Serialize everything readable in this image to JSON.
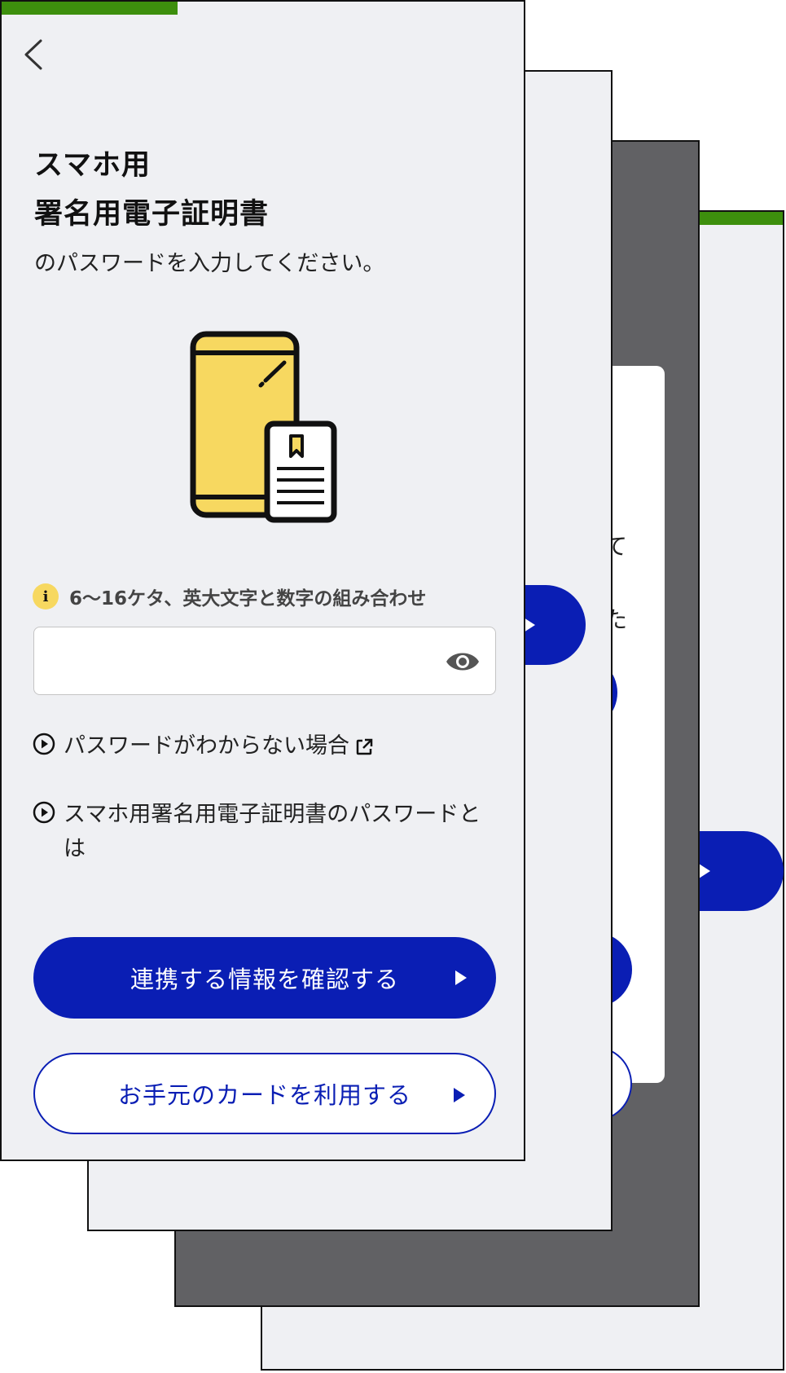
{
  "screen": {
    "title_line1": "スマホ用",
    "title_line2": "署名用電子証明書",
    "subtitle": "のパスワードを入力してください。"
  },
  "password_field": {
    "hint_icon": "i",
    "hint": "6〜16ケタ、英大文字と数字の組み合わせ",
    "value": "",
    "placeholder": "",
    "toggle_icon": "eye-icon"
  },
  "links": [
    {
      "label": "パスワードがわからない場合",
      "icon": "external-link-icon"
    },
    {
      "label": "スマホ用署名用電子証明書のパスワードとは"
    }
  ],
  "buttons": {
    "primary": "連携する情報を確認する",
    "secondary": "お手元のカードを利用する"
  },
  "background_sheets": {
    "dialog_fragments": [
      "て",
      "た"
    ]
  },
  "colors": {
    "progress": "#3d8f0d",
    "primary": "#0a1eb4",
    "background": "#eff0f3",
    "overlay": "#616164",
    "hint_badge": "#f7d860",
    "phone": "#f7d860"
  },
  "icons": [
    "chevron-left-icon",
    "info-icon",
    "eye-icon",
    "play-circle-icon",
    "external-link-icon",
    "phone-certificate-illustration"
  ]
}
